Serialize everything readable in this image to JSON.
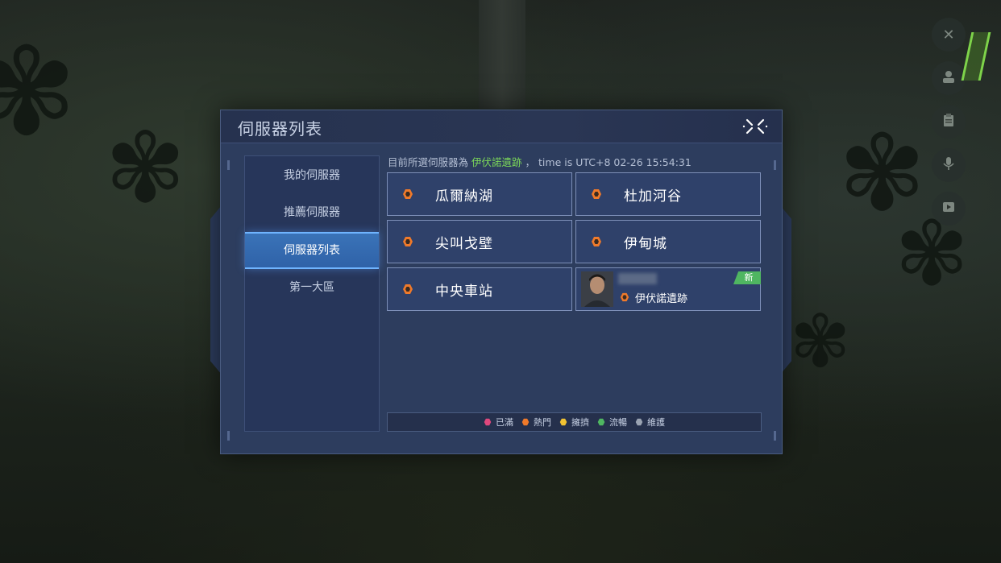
{
  "panel": {
    "title": "伺服器列表"
  },
  "nav": {
    "items": [
      {
        "label": "我的伺服器",
        "active": false
      },
      {
        "label": "推薦伺服器",
        "active": false
      },
      {
        "label": "伺服器列表",
        "active": true
      },
      {
        "label": "第一大區",
        "active": false
      }
    ]
  },
  "current": {
    "prefix": "目前所選伺服器為",
    "server": "伊伏諾遺跡",
    "separator": "，",
    "time_text": "time is UTC+8 02-26 15:54:31"
  },
  "servers": [
    {
      "name": "瓜爾納湖",
      "status": "hot"
    },
    {
      "name": "杜加河谷",
      "status": "hot"
    },
    {
      "name": "尖叫戈壁",
      "status": "hot"
    },
    {
      "name": "伊甸城",
      "status": "hot"
    },
    {
      "name": "中央車站",
      "status": "hot"
    },
    {
      "name": "伊伏諾遺跡",
      "status": "hot",
      "has_character": true,
      "badge": "新"
    }
  ],
  "legend": [
    {
      "label": "已滿",
      "status": "full",
      "color": "#e0487d"
    },
    {
      "label": "熱門",
      "status": "hot",
      "color": "#f07a2a"
    },
    {
      "label": "擁擠",
      "status": "busy",
      "color": "#f1c232"
    },
    {
      "label": "流暢",
      "status": "smooth",
      "color": "#4fb661"
    },
    {
      "label": "維護",
      "status": "maintenance",
      "color": "#9aa3b2"
    }
  ],
  "colors": {
    "accent": "#3a73b8",
    "highlight": "#7bd65a",
    "panel": "#2d3d5e"
  },
  "side_buttons": [
    {
      "icon": "wrench-icon"
    },
    {
      "icon": "user-icon"
    },
    {
      "icon": "clipboard-icon"
    },
    {
      "icon": "microphone-icon"
    },
    {
      "icon": "video-icon"
    }
  ]
}
